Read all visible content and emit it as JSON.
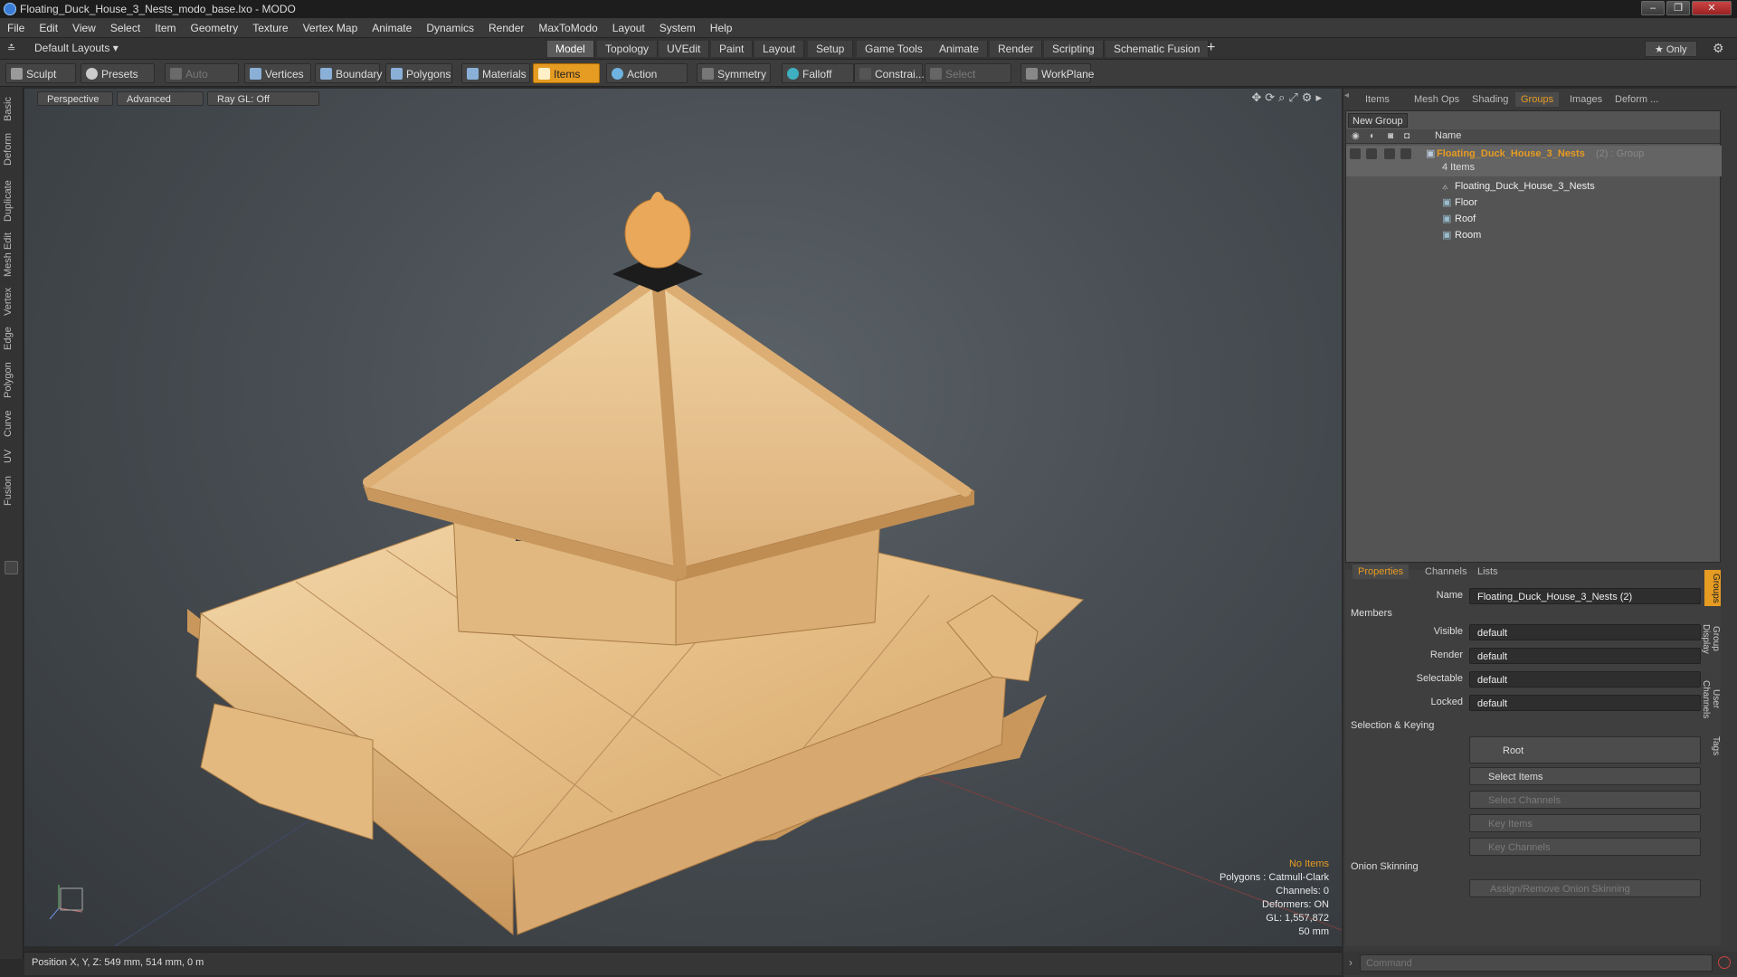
{
  "window": {
    "title": "Floating_Duck_House_3_Nests_modo_base.lxo - MODO",
    "buttons": [
      "‒",
      "❐",
      "✕"
    ]
  },
  "menu": [
    "File",
    "Edit",
    "View",
    "Select",
    "Item",
    "Geometry",
    "Texture",
    "Vertex Map",
    "Animate",
    "Dynamics",
    "Render",
    "MaxToModo",
    "Layout",
    "System",
    "Help"
  ],
  "layoutbar": {
    "layouts": "Default Layouts ▾",
    "tabs": [
      "Model",
      "Topology",
      "UVEdit",
      "Paint",
      "Layout",
      "Setup",
      "Game Tools",
      "Animate",
      "Render",
      "Scripting",
      "Schematic Fusion"
    ],
    "active_tab": "Model",
    "only": "★  Only"
  },
  "toolbar": {
    "sculpt": "Sculpt",
    "presets": "Presets",
    "auto_select": "Auto Select",
    "vertices": "Vertices",
    "boundary": "Boundary",
    "polygons": "Polygons",
    "materials": "Materials",
    "items": "Items",
    "action_center": "Action Center",
    "symmetry": "Symmetry",
    "falloff": "Falloff",
    "constraints": "Constrai...",
    "select_through": "Select Through",
    "workplane": "WorkPlane"
  },
  "lefttabs": [
    "Basic",
    "Deform",
    "Duplicate",
    "Mesh Edit",
    "Vertex",
    "Edge",
    "Polygon",
    "Curve",
    "UV",
    "Fusion"
  ],
  "viewport": {
    "perspective": "Perspective",
    "advanced": "Advanced",
    "raygl": "Ray GL: Off",
    "info": {
      "items": "No Items",
      "polygons": "Polygons : Catmull-Clark",
      "channels": "Channels: 0",
      "deformers": "Deformers: ON",
      "gl": "GL: 1,557,872",
      "scale": "50 mm"
    }
  },
  "status": {
    "position": "Position X, Y, Z:  549 mm, 514 mm, 0 m"
  },
  "rightpanel": {
    "tabs": [
      "Items",
      "Mesh Ops",
      "Shading",
      "Groups",
      "Images",
      "Deform ..."
    ],
    "active_tab": "Groups",
    "new_group": "New Group",
    "name_header": "Name",
    "group": {
      "name": "Floating_Duck_House_3_Nests",
      "suffix": "(2) : Group",
      "count": "4 Items"
    },
    "children": [
      "Floating_Duck_House_3_Nests",
      "Floor",
      "Roof",
      "Room"
    ]
  },
  "props": {
    "tabs": [
      "Properties",
      "Channels",
      "Lists"
    ],
    "name_label": "Name",
    "name_value": "Floating_Duck_House_3_Nests (2)",
    "members": "Members",
    "fields": [
      {
        "label": "Visible",
        "value": "default"
      },
      {
        "label": "Render",
        "value": "default"
      },
      {
        "label": "Selectable",
        "value": "default"
      },
      {
        "label": "Locked",
        "value": "default"
      }
    ],
    "selection_keying": "Selection & Keying",
    "root": "Root",
    "select_items": "Select Items",
    "select_channels": "Select Channels",
    "key_items": "Key Items",
    "key_channels": "Key Channels",
    "onion": "Onion Skinning",
    "onion_btn": "Assign/Remove Onion Skinning",
    "sidetabs": [
      "Groups",
      "Group Display",
      "User Channels",
      "Tags"
    ]
  },
  "command": {
    "placeholder": "Command"
  },
  "colors": {
    "accent": "#e69b22",
    "wood": "#e8c48f"
  }
}
